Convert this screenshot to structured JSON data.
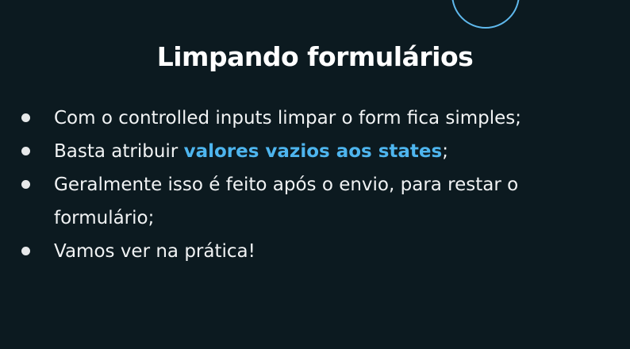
{
  "slide": {
    "title": "Limpando formulários",
    "accent_color": "#4eb5ee",
    "background_color": "#0c1a20",
    "bullets": [
      {
        "text": "Com o controlled inputs limpar o form fica simples;"
      },
      {
        "before": "Basta atribuir ",
        "highlight": "valores vazios aos states",
        "after": ";"
      },
      {
        "text": "Geralmente isso é feito após o envio, para restar o formulário;"
      },
      {
        "text": "Vamos ver na prática!"
      }
    ]
  }
}
